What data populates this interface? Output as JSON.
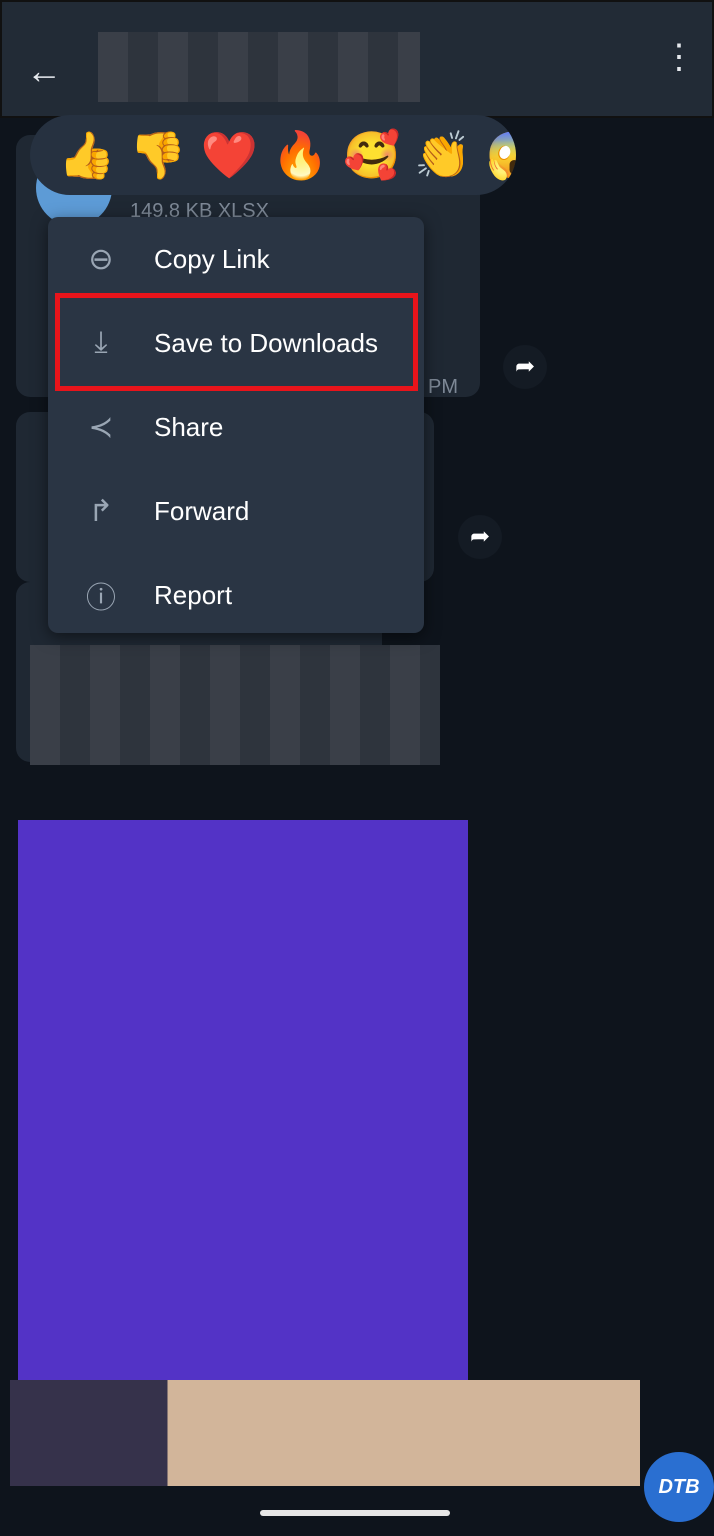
{
  "header": {
    "back_icon": "arrow-left",
    "more_icon": "more-vertical"
  },
  "reactions": [
    "👍",
    "👎",
    "❤️",
    "🔥",
    "🥰",
    "👏",
    "😱"
  ],
  "message": {
    "file_meta": "149.8 KB XLSX",
    "time_suffix": "PM"
  },
  "menu": {
    "items": [
      {
        "label": "Copy Link",
        "icon": "link",
        "glyph": "⊖"
      },
      {
        "label": "Save to Downloads",
        "icon": "download",
        "glyph": "⤓"
      },
      {
        "label": "Share",
        "icon": "share",
        "glyph": "≺"
      },
      {
        "label": "Forward",
        "icon": "forward",
        "glyph": "↱"
      },
      {
        "label": "Report",
        "icon": "alert-circle",
        "glyph": "ⓘ"
      }
    ],
    "highlighted": "Save to Downloads",
    "highlight_color": "#e8141b"
  },
  "watermark": "DTB"
}
